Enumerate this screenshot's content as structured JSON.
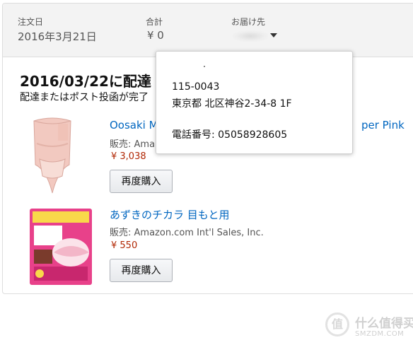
{
  "header": {
    "order_date_label": "注文日",
    "order_date_value": "2016年3月21日",
    "total_label": "合計",
    "total_value": "¥ 0",
    "ship_to_label": "お届け先"
  },
  "delivery": {
    "title": "2016/03/22に配達",
    "subtitle": "配達またはポスト投函が完了"
  },
  "items": [
    {
      "title": "Oosaki M",
      "title_tail": "per Pink",
      "seller": "販売: Ama",
      "price": "¥ 3,038",
      "rebuy_label": "再度購入"
    },
    {
      "title": "あずきのチカラ 目もと用",
      "seller": "販売: Amazon.com Int'l Sales, Inc.",
      "price": "¥ 550",
      "rebuy_label": "再度購入"
    }
  ],
  "popover": {
    "postal_code": "115-0043",
    "address": "東京都 北区神谷2-34-8 1F",
    "phone": "電話番号: 05058928605"
  },
  "watermark": {
    "icon_char": "值",
    "site_name": "什么值得买",
    "site_domain": "SMZDM.COM"
  },
  "colors": {
    "link": "#0066c0",
    "price": "#b12704",
    "header_bg": "#f3f3f3"
  }
}
